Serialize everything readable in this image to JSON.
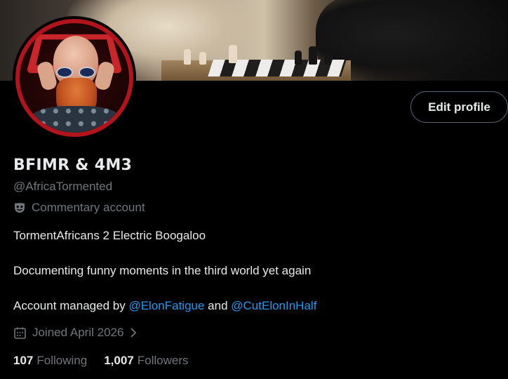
{
  "banner": {
    "description_icon": "banner-image"
  },
  "profile": {
    "display_name": "BFIMR & 4M3",
    "handle": "@AfricaTormented",
    "label_icon": "mask-icon",
    "label_text": "Commentary account",
    "edit_button_label": "Edit profile"
  },
  "bio": {
    "line1": "TormentAfricans 2 Electric Boogaloo",
    "line2": "Documenting funny moments in the third world yet again",
    "line3_prefix": "Account managed by ",
    "mention1": "@ElonFatigue",
    "line3_middle": " and ",
    "mention2": "@CutElonInHalf"
  },
  "joined": {
    "icon": "calendar-icon",
    "text": "Joined April 2026"
  },
  "stats": {
    "following_count": "107",
    "following_label": "Following",
    "followers_count": "1,007",
    "followers_label": "Followers"
  },
  "colors": {
    "accent": "#1d9bf0",
    "muted": "#71767b",
    "text": "#e7e9ea",
    "background": "#000000"
  }
}
